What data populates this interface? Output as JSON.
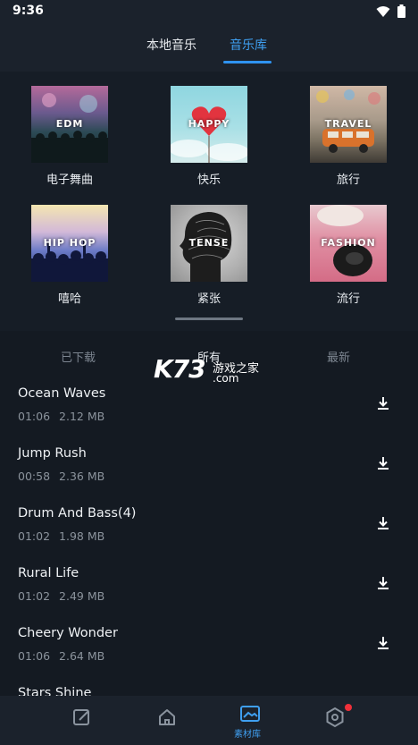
{
  "status_bar": {
    "time": "9:36"
  },
  "top_tabs": {
    "local": "本地音乐",
    "library": "音乐库"
  },
  "categories": [
    {
      "thumb_label": "EDM",
      "name": "电子舞曲"
    },
    {
      "thumb_label": "HAPPY",
      "name": "快乐"
    },
    {
      "thumb_label": "TRAVEL",
      "name": "旅行"
    },
    {
      "thumb_label": "HIP HOP",
      "name": "嘻哈"
    },
    {
      "thumb_label": "TENSE",
      "name": "紧张"
    },
    {
      "thumb_label": "FASHION",
      "name": "流行"
    }
  ],
  "filters": {
    "downloaded": "已下载",
    "all": "所有",
    "newest": "最新"
  },
  "watermark": {
    "brand": "K73",
    "site": "游戏之家",
    "domain": ".com"
  },
  "songs": [
    {
      "title": "Ocean Waves",
      "duration": "01:06",
      "size": "2.12 MB"
    },
    {
      "title": "Jump Rush",
      "duration": "00:58",
      "size": "2.36 MB"
    },
    {
      "title": "Drum And Bass(4)",
      "duration": "01:02",
      "size": "1.98 MB"
    },
    {
      "title": "Rural Life",
      "duration": "01:02",
      "size": "2.49 MB"
    },
    {
      "title": "Cheery Wonder",
      "duration": "01:06",
      "size": "2.64 MB"
    },
    {
      "title": "Stars Shine",
      "duration": "",
      "size": ""
    }
  ],
  "bottom_nav": {
    "library_label": "素材库"
  },
  "colors": {
    "accent": "#2f93f0",
    "background": "#141a22",
    "badge": "#f0303a"
  }
}
